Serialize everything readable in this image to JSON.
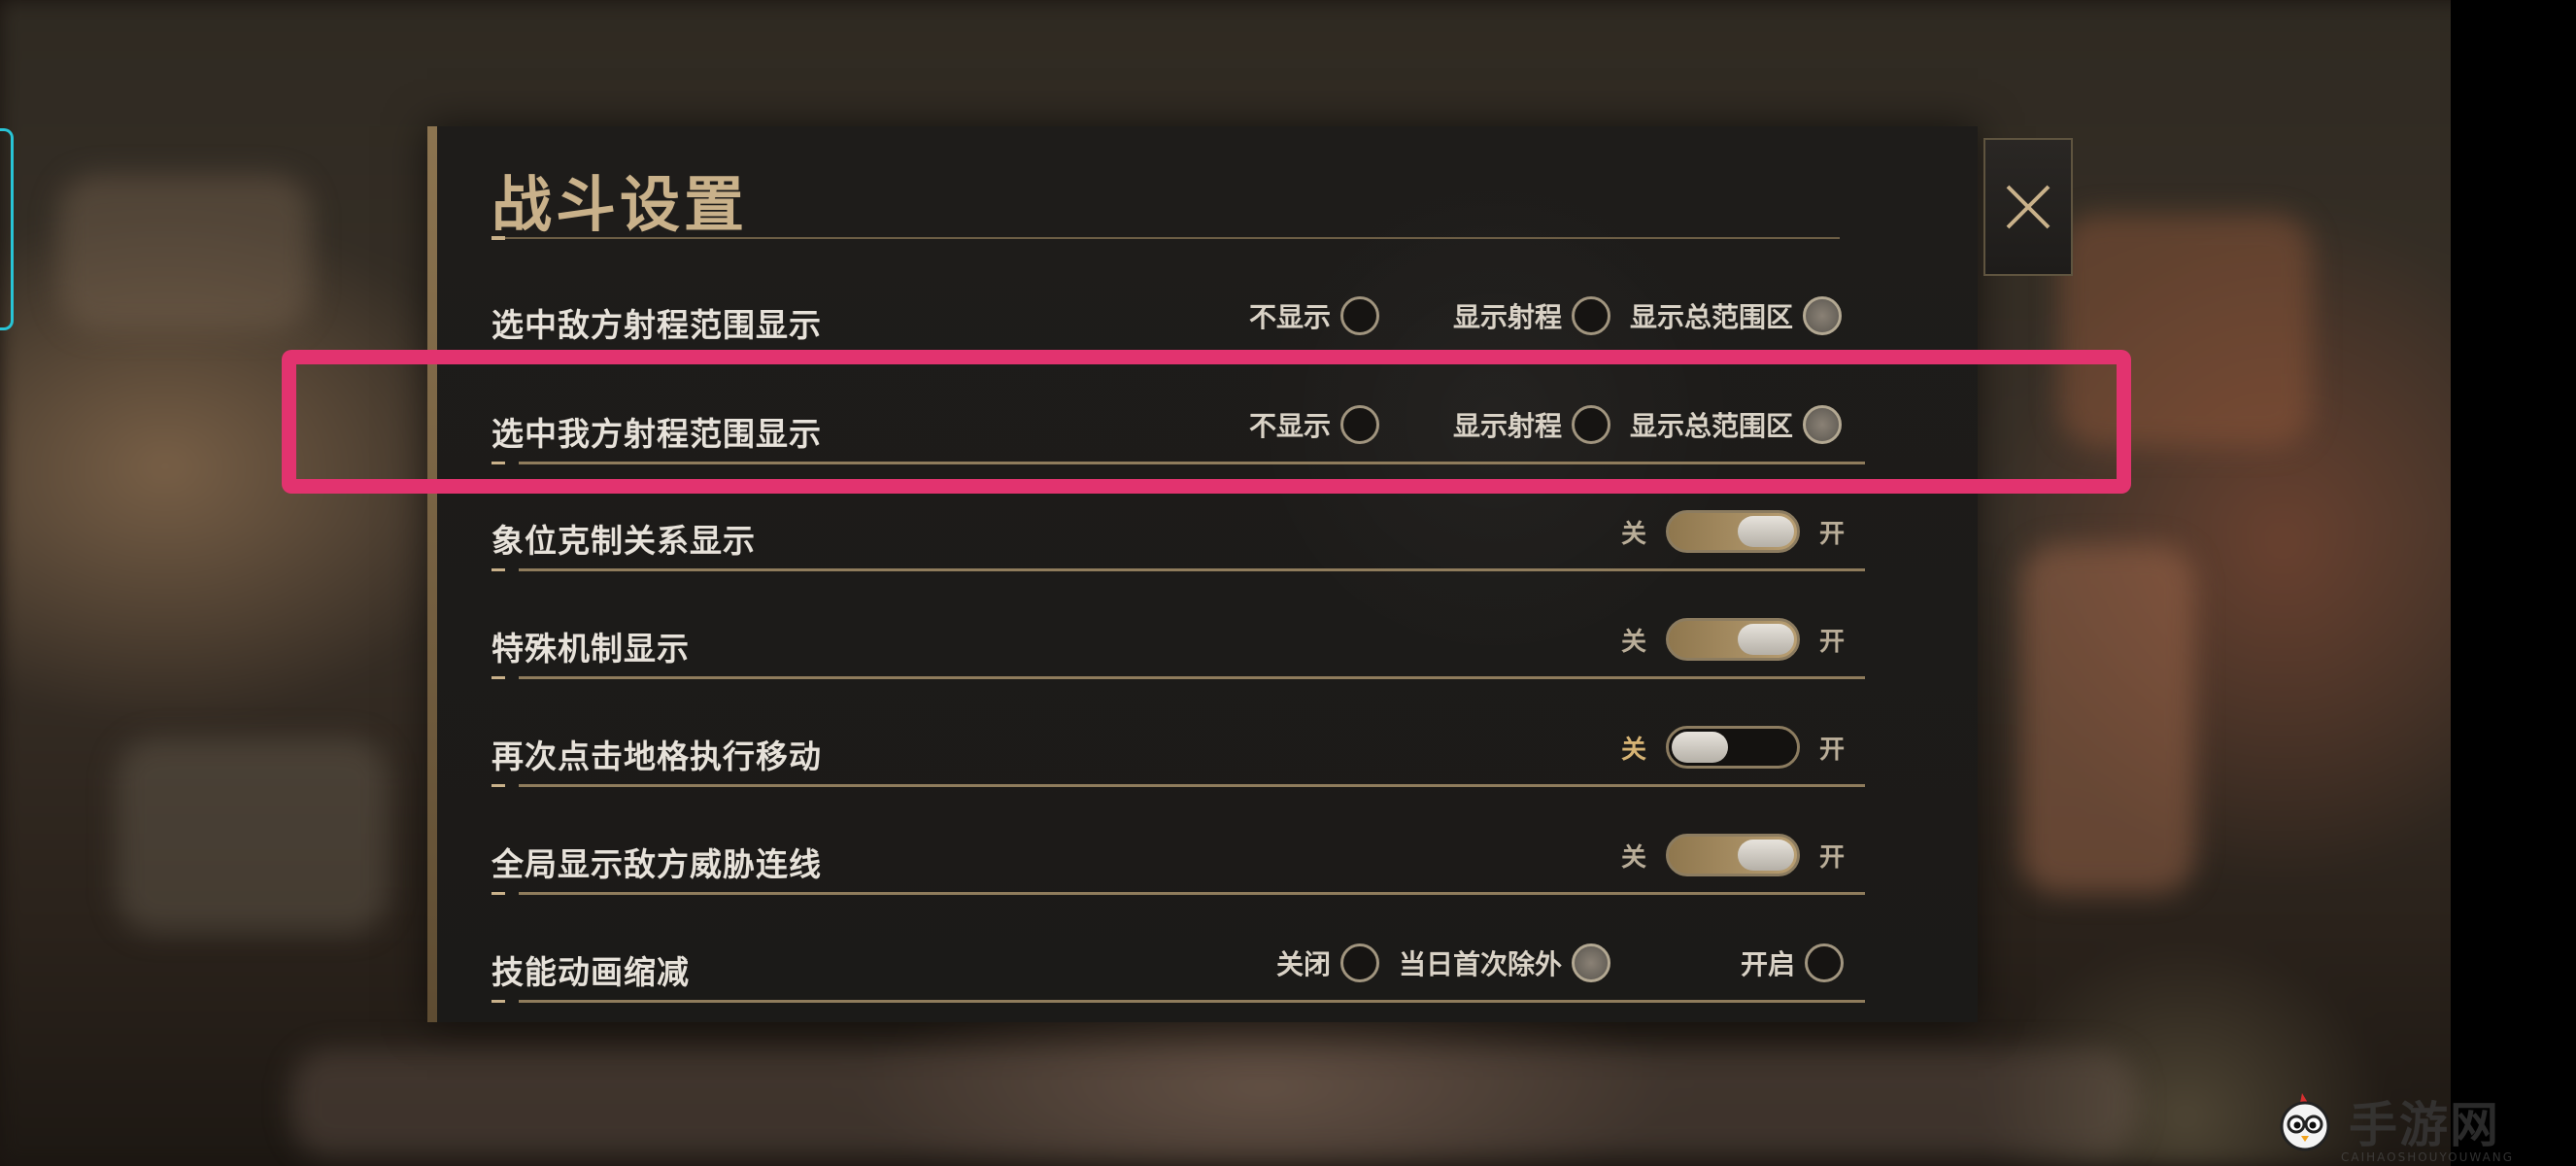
{
  "panel": {
    "title": "战斗设置"
  },
  "rows": [
    {
      "label": "选中敌方射程范围显示",
      "type": "radio",
      "options": [
        {
          "label": "不显示",
          "selected": false
        },
        {
          "label": "显示射程",
          "selected": false
        },
        {
          "label": "显示总范围区",
          "selected": true
        }
      ]
    },
    {
      "label": "选中我方射程范围显示",
      "type": "radio",
      "options": [
        {
          "label": "不显示",
          "selected": false
        },
        {
          "label": "显示射程",
          "selected": false
        },
        {
          "label": "显示总范围区",
          "selected": true
        }
      ]
    },
    {
      "label": "象位克制关系显示",
      "type": "toggle",
      "off_label": "关",
      "on_label": "开",
      "on": true
    },
    {
      "label": "特殊机制显示",
      "type": "toggle",
      "off_label": "关",
      "on_label": "开",
      "on": true
    },
    {
      "label": "再次点击地格执行移动",
      "type": "toggle",
      "off_label": "关",
      "on_label": "开",
      "on": false
    },
    {
      "label": "全局显示敌方威胁连线",
      "type": "toggle",
      "off_label": "关",
      "on_label": "开",
      "on": true
    },
    {
      "label": "技能动画缩减",
      "type": "radio",
      "options": [
        {
          "label": "关闭",
          "selected": false
        },
        {
          "label": "当日首次除外",
          "selected": true
        },
        {
          "label": "开启",
          "selected": false
        }
      ]
    }
  ],
  "watermark": {
    "text": "手游网",
    "sub": "CAIHAOSHOUYOUWANG"
  },
  "colors": {
    "accent_gold": "#c9b18a",
    "highlight": "#e2336f",
    "panel_bg": "#1c1a18"
  },
  "icons": {
    "close": "close-x-icon"
  }
}
